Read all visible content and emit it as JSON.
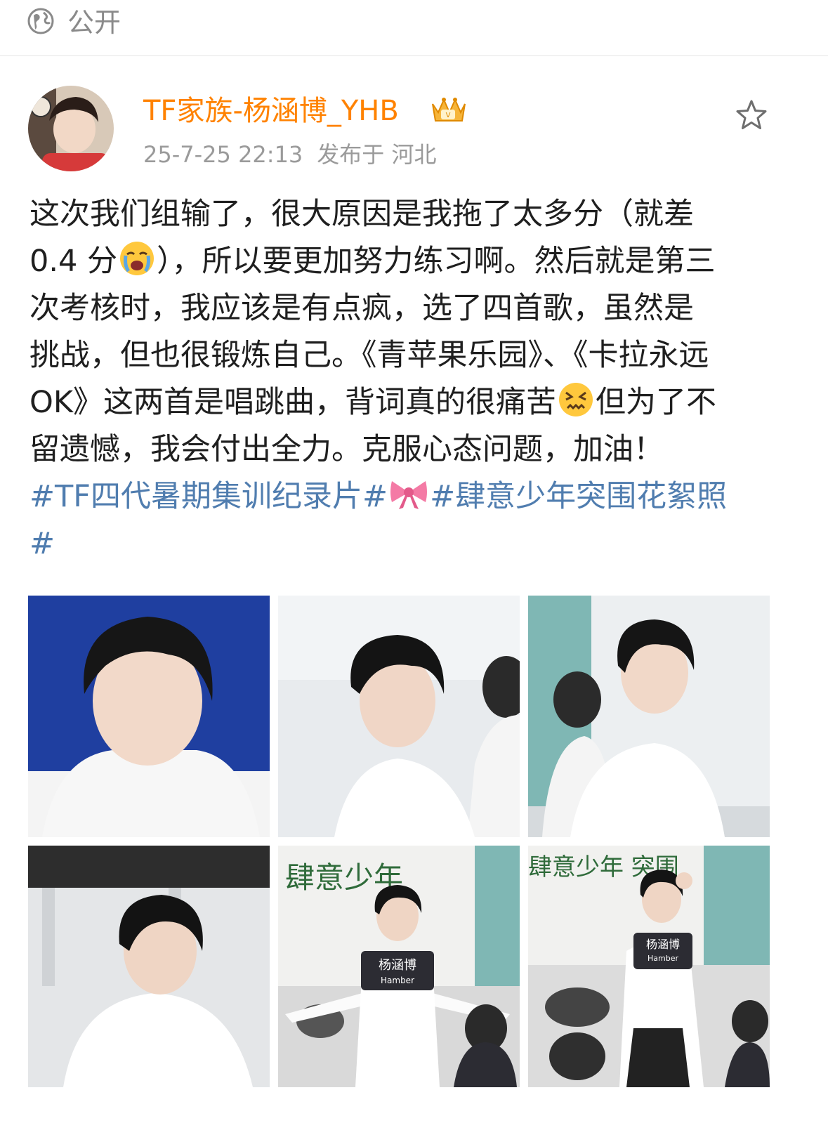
{
  "top": {
    "visibility": "公开"
  },
  "post": {
    "username": "TF家族-杨涵博_YHB",
    "date": "25-7-25 22:13",
    "location": "发布于 河北",
    "lines": [
      [
        "这次我们组输了，很大原因是我拖了太多分（就差"
      ],
      [
        "0.4 分",
        "😭",
        "），所以要更加努力练习啊。然后就是第三"
      ],
      [
        "次考核时，我应该是有点疯，选了四首歌，虽然是"
      ],
      [
        "挑战，但也很锻炼自己。《青苹果乐园》、《卡拉永远"
      ],
      [
        "OK》这两首是唱跳曲，背词真的很痛苦",
        "😖",
        "但为了不"
      ],
      [
        "留遗憾，我会付出全力。克服心态问题，加油！"
      ]
    ],
    "hashtag1": "#TF四代暑期集训纪录片#",
    "bow": "🎀",
    "hashtag2": "#肆意少年突围花絮照",
    "hashtag2_end": "#"
  },
  "photos": [
    {
      "name_tag": "",
      "board": ""
    },
    {
      "name_tag": "",
      "board": ""
    },
    {
      "name_tag": "",
      "board": ""
    },
    {
      "name_tag": "",
      "board": ""
    },
    {
      "name_tag": "杨涵博",
      "name_tag_en": "Hamber",
      "board": "肆意少年"
    },
    {
      "name_tag": "杨涵博",
      "name_tag_en": "Hamber",
      "board": "肆意少年 突围"
    }
  ],
  "colors": {
    "username": "#ff8200",
    "hashtag": "#507daf",
    "meta": "#9a9a9a"
  }
}
